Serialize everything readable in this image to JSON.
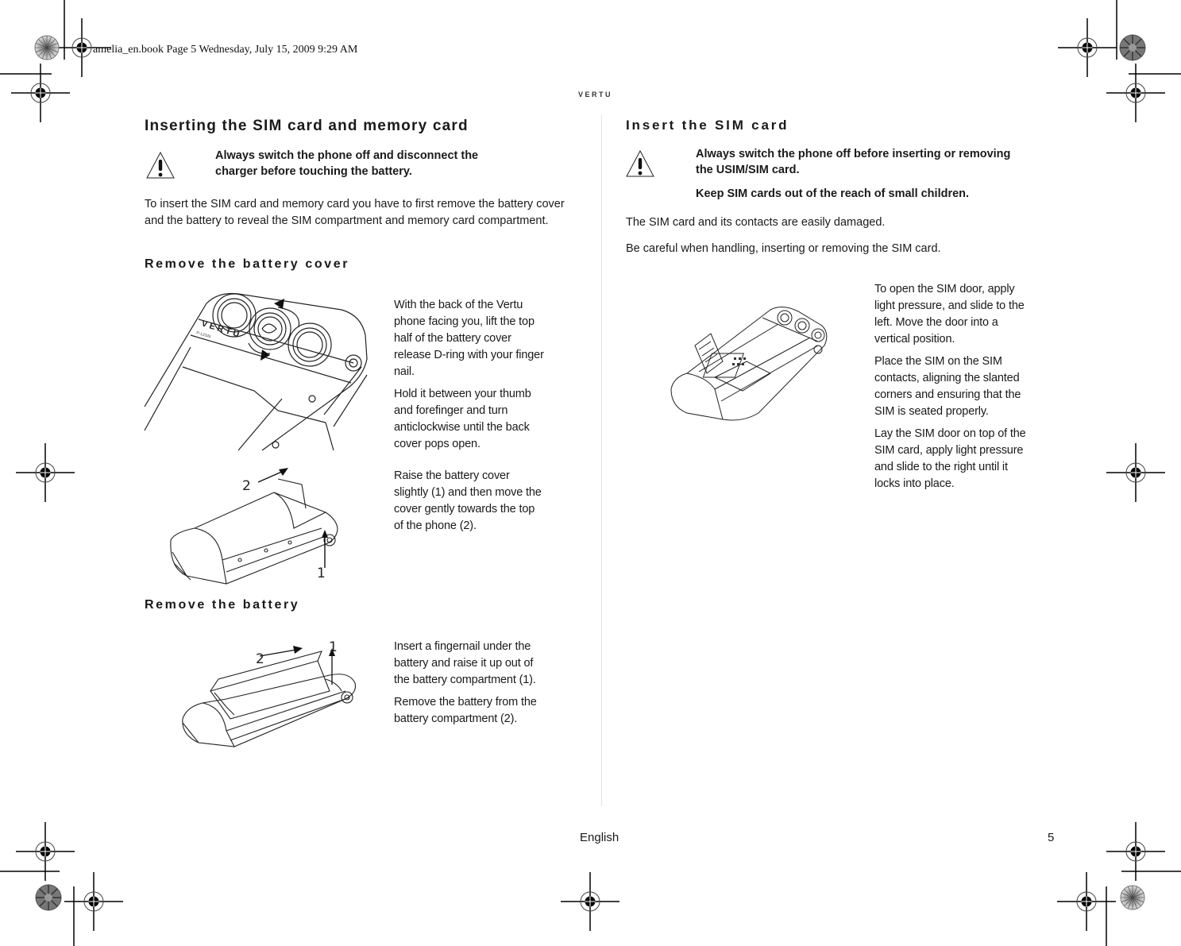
{
  "slug": "amelia_en.book  Page 5  Wednesday, July 15, 2009  9:29 AM",
  "brand": "VERTU",
  "left": {
    "title": "Inserting the SIM card and memory card",
    "warning": "Always switch the phone off and disconnect the charger before touching the battery.",
    "intro": "To insert the SIM card and memory card you have to first remove the battery cover and the battery to reveal the SIM compartment and memory card compartment.",
    "cover_section": {
      "heading": "Remove the battery cover",
      "step1": [
        "With the back of the Vertu phone facing you, lift the top half of the battery cover release D-ring with your finger nail.",
        "Hold it between your thumb and forefinger and turn anticlockwise until the back cover pops open."
      ],
      "step1_illustration": {
        "brand_mark": "VERTU",
        "serial": "P-12345"
      },
      "step2": [
        "Raise the battery cover slightly (1) and then move the cover gently towards the top of the phone (2)."
      ],
      "step2_callouts": [
        "1",
        "2"
      ]
    },
    "battery_section": {
      "heading": "Remove the battery",
      "step": [
        "Insert a fingernail under the battery and raise it up out of the battery compartment (1).",
        "Remove the battery from the battery compartment (2)."
      ],
      "callouts": [
        "1",
        "2"
      ]
    }
  },
  "right": {
    "title": "Insert the SIM card",
    "warnings": [
      "Always switch the phone off before inserting or removing the USIM/SIM card.",
      "Keep SIM cards out of the reach of small children."
    ],
    "notes": [
      "The SIM card and its contacts are easily damaged.",
      "Be careful when handling, inserting or removing the SIM card."
    ],
    "steps": [
      "To open the SIM door, apply light pressure, and slide to the left. Move the door into a vertical position.",
      "Place the SIM on the SIM contacts, aligning the slanted corners and ensuring that the SIM is seated properly.",
      "Lay the SIM door on top of the SIM card, apply light pressure and slide to the right until it locks into place."
    ]
  },
  "footer": {
    "language": "English",
    "page_number": "5"
  },
  "icons": {
    "warning": "warning-triangle-icon",
    "registration": "registration-mark-icon",
    "color_target": "color-target-icon"
  }
}
